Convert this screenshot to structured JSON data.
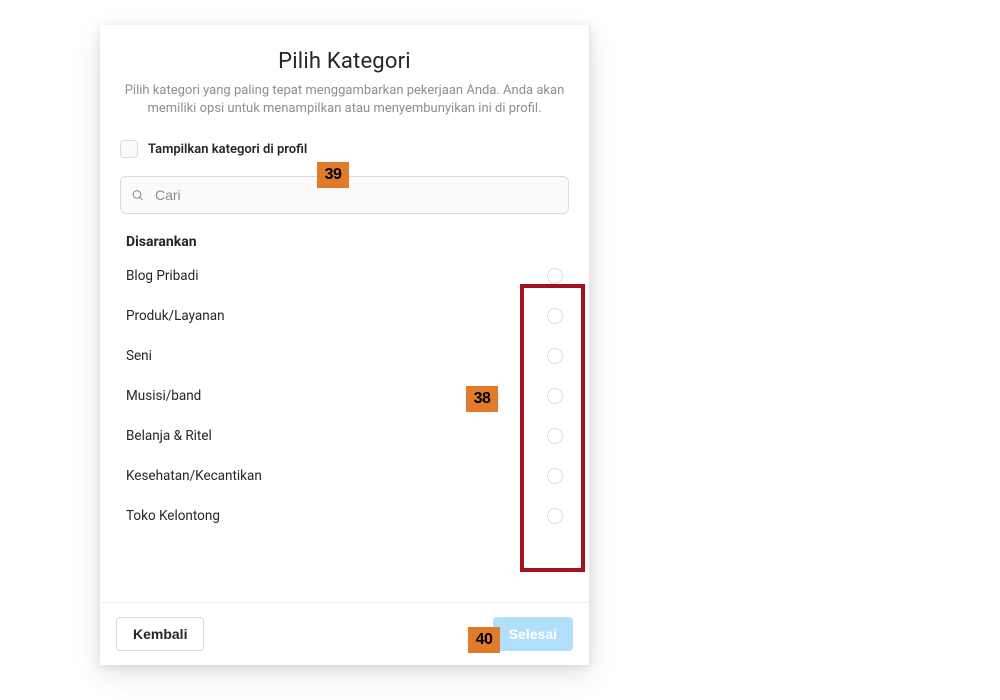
{
  "colors": {
    "annotation_orange": "#e07b2c",
    "annotation_box_red": "#a41220",
    "primary_disabled": "#b2dffc"
  },
  "modal": {
    "title": "Pilih Kategori",
    "subtitle": "Pilih kategori yang paling tepat menggambarkan pekerjaan Anda. Anda akan memiliki opsi untuk menampilkan atau menyembunyikan ini di profil.",
    "show_category_label": "Tampilkan kategori di profil",
    "search_placeholder": "Cari",
    "suggested_label": "Disarankan",
    "categories": {
      "items": [
        {
          "label": "Blog Pribadi"
        },
        {
          "label": "Produk/Layanan"
        },
        {
          "label": "Seni"
        },
        {
          "label": "Musisi/band"
        },
        {
          "label": "Belanja & Ritel"
        },
        {
          "label": "Kesehatan/Kecantikan"
        },
        {
          "label": "Toko Kelontong"
        }
      ]
    },
    "back_label": "Kembali",
    "done_label": "Selesai"
  },
  "annotations": {
    "a39": "39",
    "a38": "38",
    "a40": "40"
  }
}
